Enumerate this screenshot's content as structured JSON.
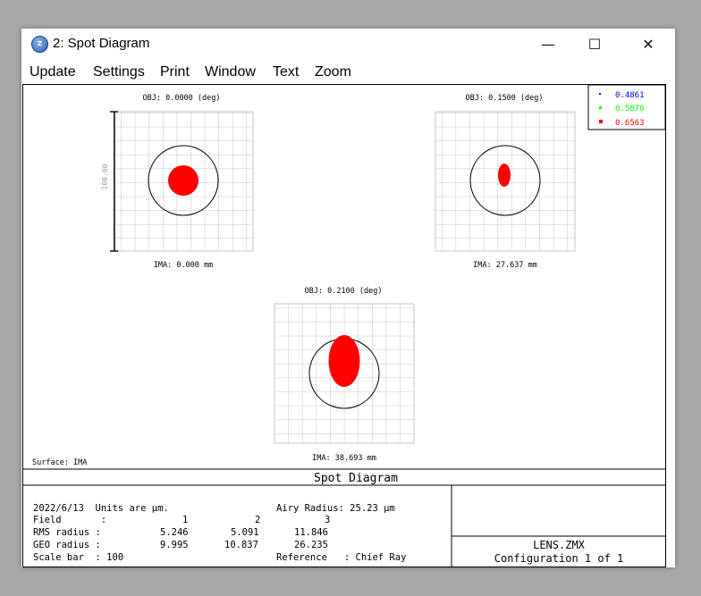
{
  "window": {
    "title": "2: Spot Diagram",
    "icon": "zemax-app-icon",
    "controls": {
      "minimize": "—",
      "maximize": "☐",
      "close": "✕"
    }
  },
  "menu": {
    "items": [
      "Update",
      "Settings",
      "Print",
      "Window",
      "Text",
      "Zoom"
    ]
  },
  "spots": [
    {
      "obj_label": "OBJ: 0.0000 (deg)",
      "ima_label": "IMA: 0.000 mm",
      "scale_label": "100.00"
    },
    {
      "obj_label": "OBJ: 0.1500 (deg)",
      "ima_label": "IMA: 27.637 mm"
    },
    {
      "obj_label": "OBJ: 0.2100 (deg)",
      "ima_label": "IMA: 38.693 mm"
    }
  ],
  "legend": [
    {
      "label": "0.4861",
      "color": "#0000ff"
    },
    {
      "label": "0.5876",
      "color": "#00ff00"
    },
    {
      "label": "0.6563",
      "color": "#ff0000"
    }
  ],
  "surface_label": "Surface: IMA",
  "footer": {
    "title": "Spot Diagram",
    "date_units": "2022/6/13  Units are µm.",
    "airy": "Airy Radius: 25.23 µm",
    "field_label": "Field       :",
    "fields": [
      "1",
      "2",
      "3"
    ],
    "rms_label": "RMS radius :",
    "rms": [
      "5.246",
      "5.091",
      "11.846"
    ],
    "geo_label": "GEO radius :",
    "geo": [
      "9.995",
      "10.837",
      "26.235"
    ],
    "scale_bar": "Scale bar  : 100",
    "reference": "Reference   : Chief Ray",
    "lens_file": "LENS.ZMX",
    "configuration": "Configuration 1 of 1"
  }
}
